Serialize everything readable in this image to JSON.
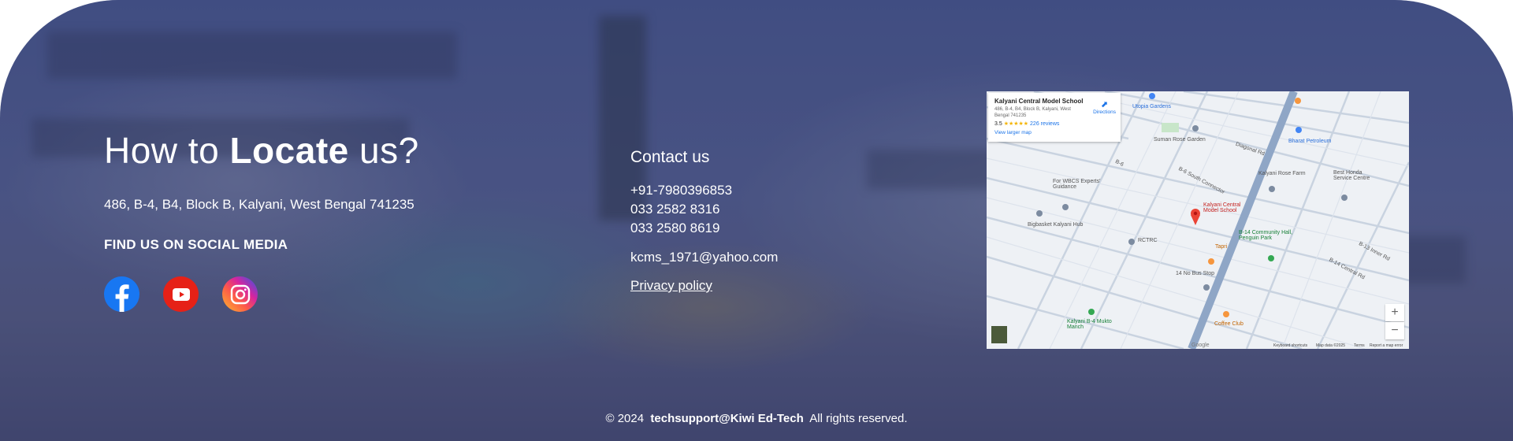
{
  "locate": {
    "title_prefix": "How to",
    "title_bold": "Locate",
    "title_suffix": "us?",
    "address": "486, B-4, B4, Block B, Kalyani, West Bengal 741235",
    "social_heading": "FIND US ON SOCIAL MEDIA",
    "social_icons": [
      "facebook-icon",
      "youtube-icon",
      "instagram-icon"
    ]
  },
  "contact": {
    "heading": "Contact us",
    "phones": [
      "+91-7980396853",
      "033 2582 8316",
      "033 2580 8619"
    ],
    "email": "kcms_1971@yahoo.com",
    "privacy_label": "Privacy policy"
  },
  "map": {
    "place_name": "Kalyani Central Model School",
    "place_address": "486, B-4, B4, Block B, Kalyani, West Bengal 741235",
    "rating": "3.5",
    "stars": "★★★★★",
    "reviews": "226 reviews",
    "larger_map": "View larger map",
    "directions": "Directions",
    "zoom_in": "+",
    "zoom_out": "−",
    "labels": {
      "utopia": "Utopia Gardens",
      "suman": "Suman Rose Garden",
      "wbcs": "For WBCS Experts' Guidance",
      "bigbasket": "Bigbasket Kalyani Hub",
      "rctrc": "RCTRC",
      "marker": "Kalyani Central Model School",
      "tapri": "Tapri",
      "community": "B-14 Community Hall, Penguin Park",
      "bus": "14 No Bus Stop",
      "mukto": "Kalyani B-4 Mukto Manch",
      "coffee": "Coffee Club",
      "rose_farm": "Kalyani Rose Farm",
      "honda": "Best Honda Service Centre",
      "petroleum": "Bharat Petroleum",
      "south_conn": "B-6 South Connector",
      "inner_rd": "B-13 Inner Rd",
      "central_rd": "B-14 Central Rd",
      "diagonal": "Diagonal Rd",
      "b6": "B-6"
    },
    "attribution": {
      "shortcuts": "Keyboard shortcuts",
      "data": "Map data ©2025",
      "terms": "Terms",
      "report": "Report a map error",
      "google": "Google"
    }
  },
  "copyright": {
    "prefix": "© 2024",
    "company": "techsupport@Kiwi Ed-Tech",
    "suffix": "All rights reserved."
  },
  "colors": {
    "facebook": "#1877f2",
    "youtube": "#e62117",
    "overlay": "#4b5a8e",
    "marker": "#ea4335",
    "water": "#8fa6c6"
  }
}
